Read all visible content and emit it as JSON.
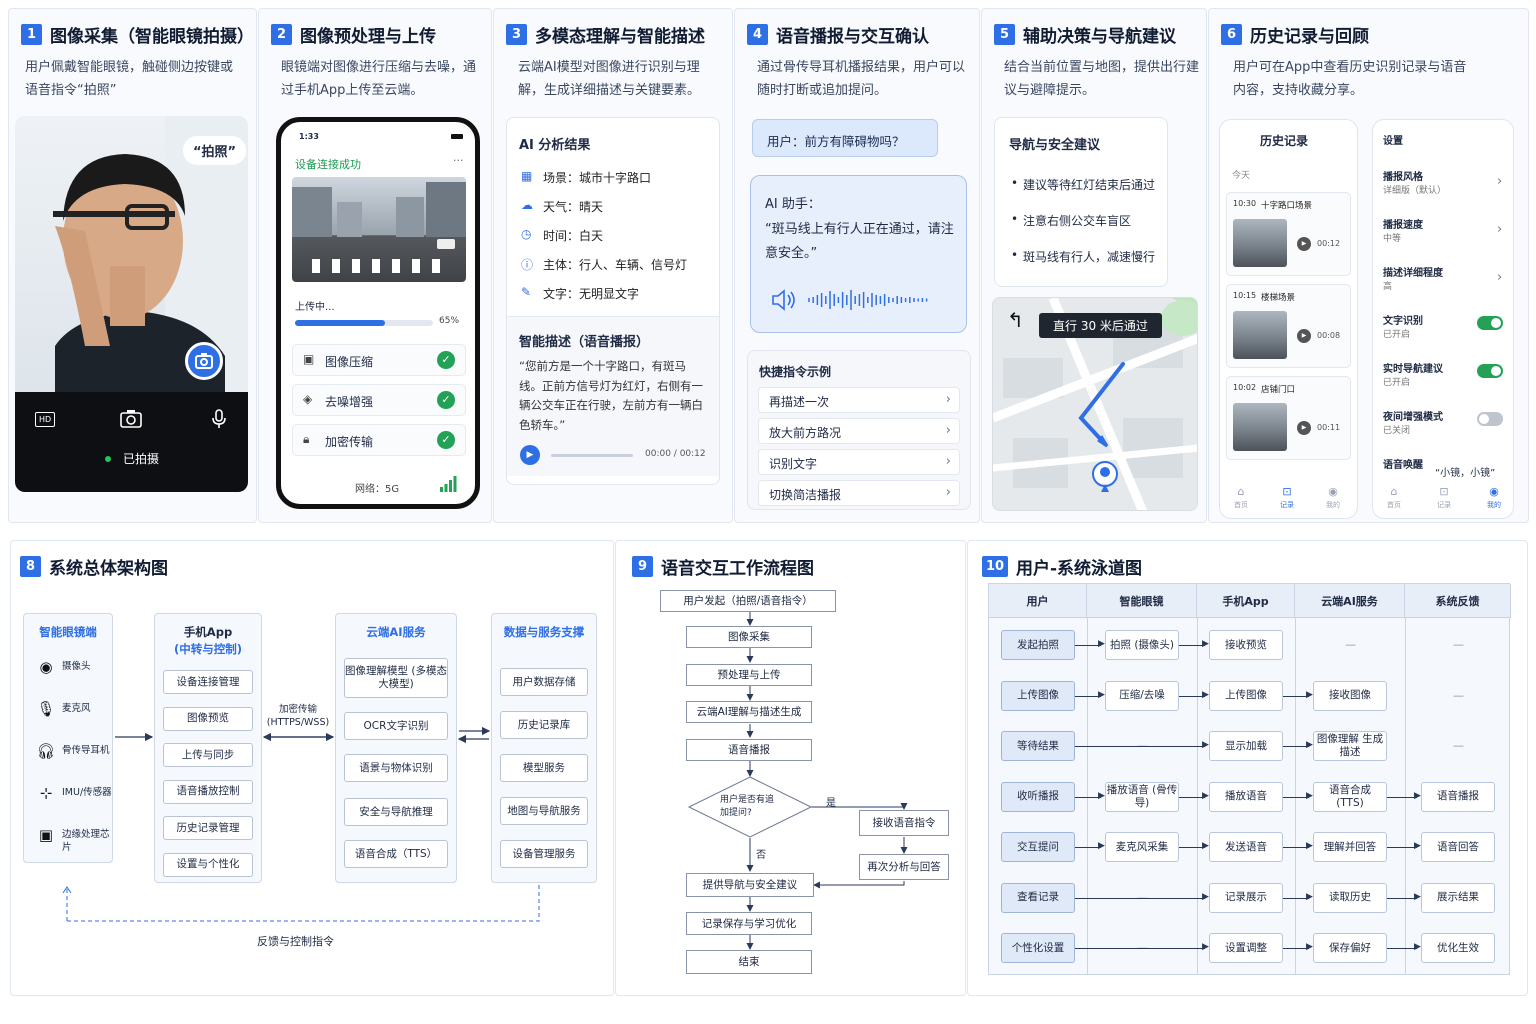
{
  "colors": {
    "accent": "#2f6fe5",
    "success": "#22a157",
    "panel_bg": "#f8fafd"
  },
  "sections": {
    "s1": {
      "num": "1",
      "title": "图像采集（智能眼镜拍摄）",
      "desc": "用户佩戴智能眼镜，触碰侧边按键或语音指令“拍照”",
      "bubble": "“拍照”",
      "hd": "HD",
      "status": "已拍摄"
    },
    "s2": {
      "num": "2",
      "title": "图像预处理与上传",
      "desc": "眼镜端对图像进行压缩与去噪，通过手机App上传至云端。",
      "time": "1:33",
      "connected": "设备连接成功",
      "uploading": "上传中...",
      "progress": "65%",
      "progress_value": 0.65,
      "steps": [
        "图像压缩",
        "去噪增强",
        "加密传输"
      ],
      "network": "网络：5G"
    },
    "s3": {
      "num": "3",
      "title": "多模态理解与智能描述",
      "desc": "云端AI模型对图像进行识别与理解，生成详细描述与关键要素。",
      "card_title": "AI 分析结果",
      "items": [
        "场景：城市十字路口",
        "天气：晴天",
        "时间：白天",
        "主体：行人、车辆、信号灯",
        "文字：无明显文字"
      ],
      "narration_title": "智能描述（语音播报）",
      "narration": "“您前方是一个十字路口，有斑马线。正前方信号灯为红灯，右侧有一辆公交车正在行驶，左前方有一辆白色轿车。”",
      "audio_time": "00:00 / 00:12",
      "audio_current": 0,
      "audio_total": 12
    },
    "s4": {
      "num": "4",
      "title": "语音播报与交互确认",
      "desc": "通过骨传导耳机播报结果，用户可以随时打断或追加提问。",
      "user_msg": "用户：前方有障碍物吗？",
      "ai_label": "AI 助手：",
      "ai_msg": "“斑马线上有行人正在通过，请注意安全。”",
      "quick_title": "快捷指令示例",
      "quick": [
        "再描述一次",
        "放大前方路况",
        "识别文字",
        "切换简洁播报"
      ]
    },
    "s5": {
      "num": "5",
      "title": "辅助决策与导航建议",
      "desc": "结合当前位置与地图，提供出行建议与避障提示。",
      "card_title": "导航与安全建议",
      "tips": [
        "建议等待红灯结束后通过",
        "注意右侧公交车盲区",
        "斑马线有行人，减速慢行"
      ],
      "nav": "直行 30 米后通过"
    },
    "s6": {
      "num": "6",
      "title": "历史记录与回顾",
      "desc": "用户可在App中查看历史识别记录与语音内容，支持收藏分享。",
      "history_title": "历史记录",
      "today": "今天",
      "records": [
        {
          "time": "10:30",
          "name": "十字路口场景",
          "dur": "00:12"
        },
        {
          "time": "10:15",
          "name": "楼梯场景",
          "dur": "00:08"
        },
        {
          "time": "10:02",
          "name": "店铺门口",
          "dur": "00:11"
        }
      ],
      "settings_title": "设置",
      "settings": [
        {
          "name": "播报风格",
          "value": "详细版（默认）",
          "kind": "arrow"
        },
        {
          "name": "播报速度",
          "value": "中等",
          "kind": "arrow"
        },
        {
          "name": "描述详细程度",
          "value": "高",
          "kind": "arrow"
        },
        {
          "name": "文字识别",
          "value": "已开启",
          "kind": "on"
        },
        {
          "name": "实时导航建议",
          "value": "已开启",
          "kind": "on"
        },
        {
          "name": "夜间增强模式",
          "value": "已关闭",
          "kind": "off"
        }
      ],
      "wake_name": "语音唤醒",
      "wake_value": "“小镜，小镜”",
      "tabs_left": [
        "首页",
        "记录",
        "我的"
      ],
      "tabs_right": [
        "首页",
        "记录",
        "我的"
      ]
    },
    "s8": {
      "num": "8",
      "title": "系统总体架构图",
      "col1": {
        "title": "智能眼镜端",
        "items": [
          "摄像头",
          "麦克风",
          "骨传导耳机",
          "IMU/传感器",
          "边缘处理芯片"
        ]
      },
      "col2": {
        "title": "手机App",
        "subtitle": "(中转与控制)",
        "items": [
          "设备连接管理",
          "图像预览",
          "上传与同步",
          "语音播放控制",
          "历史记录管理",
          "设置与个性化"
        ]
      },
      "link": "加密传输 (HTTPS/WSS)",
      "col3": {
        "title": "云端AI服务",
        "items": [
          "图像理解模型 (多模态大模型)",
          "OCR文字识别",
          "语景与物体识别",
          "安全与导航推理",
          "语音合成（TTS）"
        ]
      },
      "col4": {
        "title": "数据与服务支撑",
        "items": [
          "用户数据存储",
          "历史记录库",
          "模型服务",
          "地图与导航服务",
          "设备管理服务"
        ]
      },
      "feedback": "反馈与控制指令"
    },
    "s9": {
      "num": "9",
      "title": "语音交互工作流程图",
      "steps": [
        "用户发起（拍照/语音指令）",
        "图像采集",
        "预处理与上传",
        "云端AI理解与描述生成",
        "语音播报"
      ],
      "decision": "用户是否有追加提问?",
      "yes": "是",
      "no": "否",
      "branch": [
        "接收语音指令",
        "再次分析与回答"
      ],
      "after": [
        "提供导航与安全建议",
        "记录保存与学习优化",
        "结束"
      ]
    },
    "s10": {
      "num": "10",
      "title": "用户-系统泳道图",
      "headers": [
        "用户",
        "智能眼镜",
        "手机App",
        "云端AI服务",
        "系统反馈"
      ],
      "rows": [
        [
          "发起拍照",
          "拍照 (摄像头)",
          "接收预览",
          "—",
          "—"
        ],
        [
          "上传图像",
          "压缩/去噪",
          "上传图像",
          "接收图像",
          "—"
        ],
        [
          "等待结果",
          "—",
          "显示加载",
          "图像理解 生成描述",
          "—"
        ],
        [
          "收听播报",
          "播放语音 (骨传导)",
          "播放语音",
          "语音合成 (TTS)",
          "语音播报"
        ],
        [
          "交互提问",
          "麦克风采集",
          "发送语音",
          "理解并回答",
          "语音回答"
        ],
        [
          "查看记录",
          "—",
          "记录展示",
          "读取历史",
          "展示结果"
        ],
        [
          "个性化设置",
          "—",
          "设置调整",
          "保存偏好",
          "优化生效"
        ]
      ]
    }
  }
}
